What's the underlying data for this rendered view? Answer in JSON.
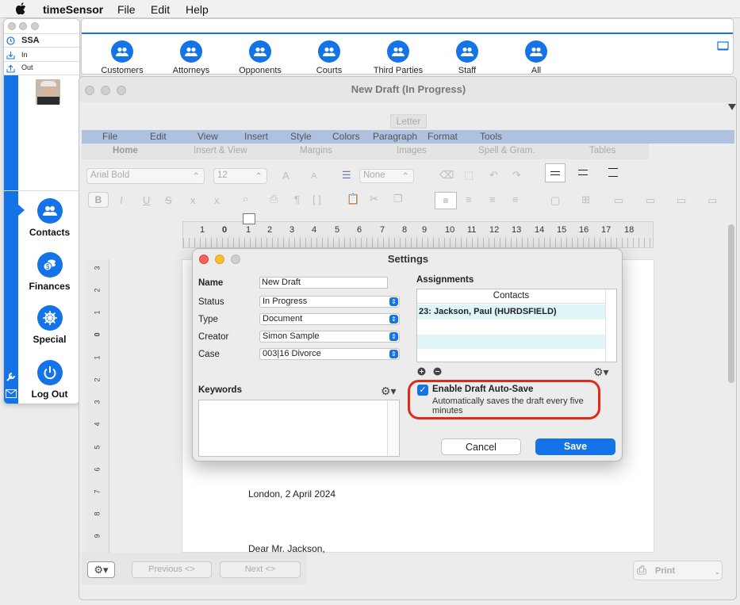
{
  "menubar": {
    "app": "timeSensor",
    "file": "File",
    "edit": "Edit",
    "help": "Help"
  },
  "sidewin": {
    "title": "SSA",
    "in": "In",
    "out": "Out",
    "nav": [
      {
        "label": "Contacts"
      },
      {
        "label": "Finances"
      },
      {
        "label": "Special"
      },
      {
        "label": "Log Out"
      }
    ]
  },
  "categories": [
    "Customers",
    "Attorneys",
    "Opponents",
    "Courts",
    "Third Parties",
    "Staff",
    "All"
  ],
  "doc": {
    "title": "New Draft (In Progress)",
    "letter": "Letter",
    "menu": [
      "File",
      "Edit",
      "View",
      "Insert",
      "Style",
      "Colors",
      "Paragraph",
      "Format",
      "Tools"
    ],
    "tabs": [
      "Home",
      "Insert & View",
      "Margins",
      "Images",
      "Spell & Gram.",
      "Tables"
    ],
    "font": "Arial Bold",
    "size": "12",
    "liststyle": "None",
    "ruler": [
      "1",
      "0",
      "1",
      "2",
      "3",
      "4",
      "5",
      "6",
      "7",
      "8",
      "9",
      "10",
      "11",
      "12",
      "13",
      "14",
      "15",
      "16",
      "17",
      "18"
    ],
    "vruler": [
      "3",
      "2",
      "1",
      "0",
      "1",
      "2",
      "3",
      "4",
      "5",
      "6",
      "7",
      "8",
      "9"
    ],
    "line1": "London, 2 April 2024",
    "line2": "Dear Mr. Jackson,",
    "previous": "Previous <>",
    "next": "Next <>",
    "print": "Print"
  },
  "settings": {
    "title": "Settings",
    "name_label": "Name",
    "name_value": "New Draft",
    "status_label": "Status",
    "status_value": "In Progress",
    "type_label": "Type",
    "type_value": "Document",
    "creator_label": "Creator",
    "creator_value": "Simon Sample",
    "case_label": "Case",
    "case_value": "003|16 Divorce",
    "keywords_label": "Keywords",
    "assignments_label": "Assignments",
    "contacts_header": "Contacts",
    "contact_row": "23: Jackson, Paul (HURDSFIELD)",
    "autosave_label": "Enable Draft Auto-Save",
    "autosave_desc": "Automatically saves the draft every five minutes",
    "autosave_checked": true,
    "cancel": "Cancel",
    "save": "Save"
  },
  "colors": {
    "accent": "#1473e6",
    "highlight": "#e02a1a"
  }
}
